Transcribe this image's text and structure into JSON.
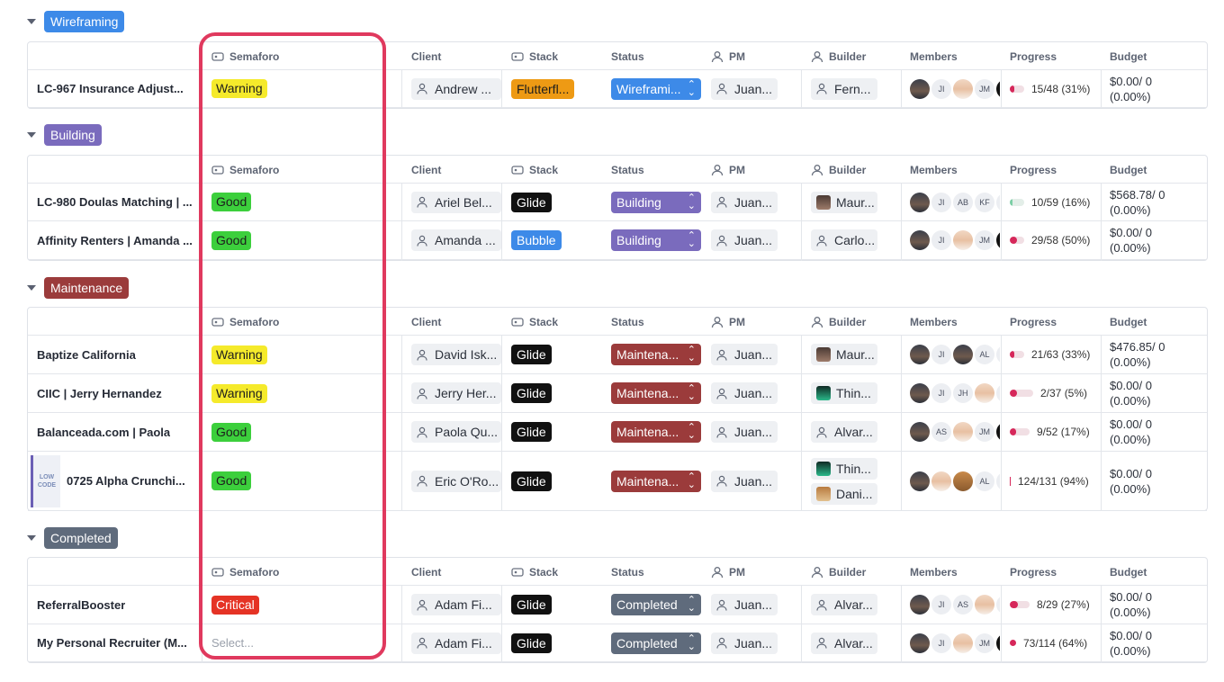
{
  "headers": {
    "semaforo": "Semaforo",
    "client": "Client",
    "stack": "Stack",
    "status": "Status",
    "pm": "PM",
    "builder": "Builder",
    "members": "Members",
    "progress": "Progress",
    "budget": "Budget"
  },
  "colors": {
    "wireframing": "#3d8ae8",
    "building": "#7a6bbd",
    "maintenance": "#9b3b3b",
    "completed": "#5f6b7c",
    "stack_glide": "#111111",
    "stack_bubble": "#3d8ae8",
    "stack_flutterflow": "#ee9a14",
    "highlight": "#e0395e"
  },
  "groups": [
    {
      "label": "Wireframing",
      "color": "#3d8ae8",
      "rows": [
        {
          "name": "LC-967 Insurance Adjust...",
          "semaforo": "Warning",
          "client": "Andrew ...",
          "stack": "Flutterfl...",
          "status": "Wireframi...",
          "pm": "Juan...",
          "builder": "Fern...",
          "members": [
            "photo",
            "JI",
            "photo",
            "JM",
            "photo"
          ],
          "progress_text": "15/48 (31%)",
          "progress": 0.31,
          "budget_1": "$0.00/ 0",
          "budget_2": "(0.00%)"
        }
      ]
    },
    {
      "label": "Building",
      "color": "#7a6bbd",
      "rows": [
        {
          "name": "LC-980 Doulas Matching | ...",
          "semaforo": "Good",
          "client": "Ariel Bel...",
          "stack": "Glide",
          "status": "Building",
          "pm": "Juan...",
          "builder": "Maur...",
          "members": [
            "photo",
            "JI",
            "AB",
            "KF",
            "J"
          ],
          "progress_text": "10/59 (16%)",
          "progress": 0.16,
          "budget_1": "$568.78/ 0",
          "budget_2": "(0.00%)"
        },
        {
          "name": "Affinity Renters | Amanda ...",
          "semaforo": "Good",
          "client": "Amanda ...",
          "stack": "Bubble",
          "status": "Building",
          "pm": "Juan...",
          "builder": "Carlo...",
          "members": [
            "photo",
            "JI",
            "photo",
            "JM",
            "photo"
          ],
          "progress_text": "29/58 (50%)",
          "progress": 0.5,
          "budget_1": "$0.00/ 0",
          "budget_2": "(0.00%)"
        }
      ]
    },
    {
      "label": "Maintenance",
      "color": "#9b3b3b",
      "rows": [
        {
          "name": "Baptize California",
          "semaforo": "Warning",
          "client": "David Isk...",
          "stack": "Glide",
          "status": "Maintena...",
          "pm": "Juan...",
          "builder": "Maur...",
          "members": [
            "photo",
            "JI",
            "photo",
            "AL",
            "T"
          ],
          "progress_text": "21/63 (33%)",
          "progress": 0.33,
          "budget_1": "$476.85/ 0",
          "budget_2": "(0.00%)"
        },
        {
          "name": "CIIC | Jerry Hernandez",
          "semaforo": "Warning",
          "client": "Jerry Her...",
          "stack": "Glide",
          "status": "Maintena...",
          "pm": "Juan...",
          "builder": "Thin...",
          "members": [
            "photo",
            "JI",
            "JH",
            "photo",
            "J"
          ],
          "progress_text": "2/37 (5%)",
          "progress": 0.05,
          "budget_1": "$0.00/ 0",
          "budget_2": "(0.00%)"
        },
        {
          "name": "Balanceada.com | Paola",
          "semaforo": "Good",
          "client": "Paola Qu...",
          "stack": "Glide",
          "status": "Maintena...",
          "pm": "Juan...",
          "builder": "Alvar...",
          "members": [
            "photo",
            "AS",
            "photo",
            "JM",
            "photo"
          ],
          "progress_text": "9/52 (17%)",
          "progress": 0.17,
          "budget_1": "$0.00/ 0",
          "budget_2": "(0.00%)"
        },
        {
          "name": "0725 Alpha Crunchi...",
          "semaforo": "Good",
          "client": "Eric O'Ro...",
          "stack": "Glide",
          "status": "Maintena...",
          "pm": "Juan...",
          "builder": "Thin...",
          "builder_2": "Dani...",
          "thumb_text": "LOW CODE",
          "members": [
            "photo",
            "photo",
            "photo",
            "AL",
            "J"
          ],
          "progress_text": "124/131 (94%)",
          "progress": 0.94,
          "budget_1": "$0.00/ 0",
          "budget_2": "(0.00%)"
        }
      ]
    },
    {
      "label": "Completed",
      "color": "#5f6b7c",
      "rows": [
        {
          "name": "ReferralBooster",
          "semaforo": "Critical",
          "client": "Adam Fi...",
          "stack": "Glide",
          "status": "Completed",
          "pm": "Juan...",
          "builder": "Alvar...",
          "members": [
            "photo",
            "JI",
            "AS",
            "photo",
            "J"
          ],
          "progress_text": "8/29 (27%)",
          "progress": 0.27,
          "budget_1": "$0.00/ 0",
          "budget_2": "(0.00%)"
        },
        {
          "name": "My Personal Recruiter (M...",
          "semaforo": "",
          "semaforo_placeholder": "Select...",
          "client": "Adam Fi...",
          "stack": "Glide",
          "status": "Completed",
          "pm": "Juan...",
          "builder": "Alvar...",
          "members": [
            "photo",
            "JI",
            "photo",
            "JM",
            "photo"
          ],
          "progress_text": "73/114 (64%)",
          "progress": 0.64,
          "budget_1": "$0.00/ 0",
          "budget_2": "(0.00%)"
        }
      ]
    }
  ]
}
